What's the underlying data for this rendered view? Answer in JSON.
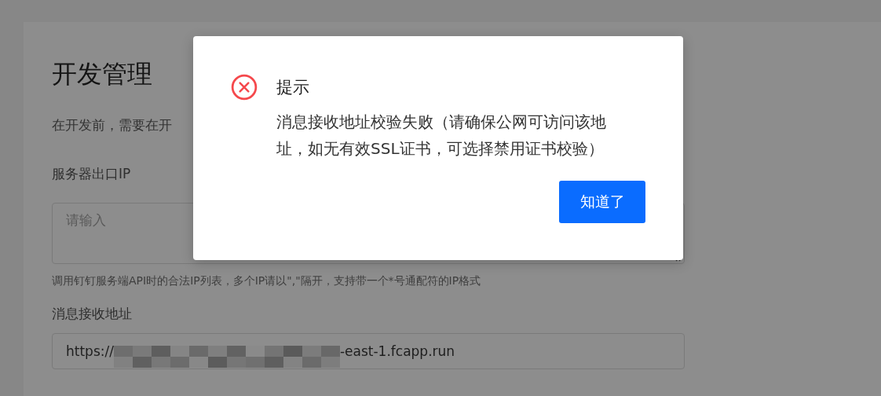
{
  "page": {
    "title": "开发管理",
    "description": "在开发前，需要在开",
    "fields": [
      {
        "kind": "textarea",
        "label": "服务器出口IP",
        "placeholder": "请输入",
        "help": "调用钉钉服务端API时的合法IP列表，多个IP请以\",\"隔开，支持带一个*号通配符的IP格式"
      },
      {
        "kind": "input",
        "label": "消息接收地址",
        "value_parts": [
          {
            "kind": "text",
            "text": "https://"
          },
          {
            "kind": "redacted"
          },
          {
            "kind": "text",
            "text": "-east-1.fcapp.run"
          }
        ]
      }
    ]
  },
  "dialog": {
    "kind": "error",
    "title": "提示",
    "message": "消息接收地址校验失败（请确保公网可访问该地址，如无有效SSL证书，可选择禁用证书校验）",
    "button": "知道了"
  }
}
